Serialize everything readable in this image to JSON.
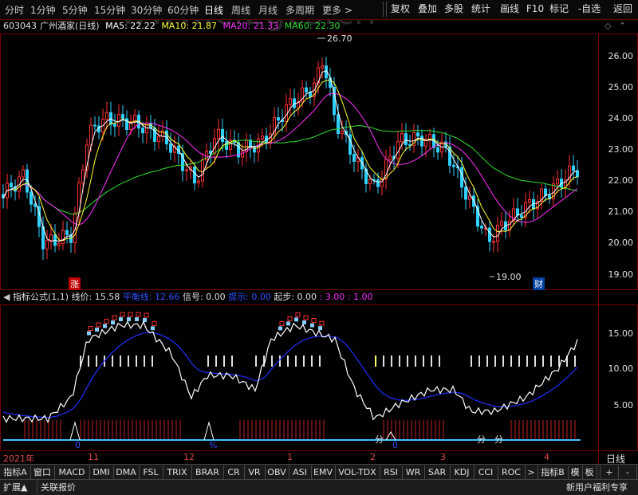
{
  "watermark": "www.cfzgcs.cn",
  "top_bar": {
    "period_tabs": [
      "分时",
      "1分钟",
      "5分钟",
      "15分钟",
      "30分钟",
      "60分钟",
      "日线",
      "周线",
      "月线",
      "多周期",
      "更多 >"
    ],
    "active_tab": "日线",
    "buttons": [
      "复权",
      "叠加",
      "多股",
      "统计",
      "画线",
      "F10",
      "标记",
      "-自选",
      "返回"
    ]
  },
  "info_line": {
    "code": "603043",
    "name": "广州酒家",
    "period": "(日线)",
    "ma5": "MA5: 22.22",
    "ma10": "MA10: 21.87",
    "ma20": "MA20: 21.33",
    "ma60": "MA60: 22.30",
    "icons": [
      "diamond-icon",
      "chevron-up-icon"
    ]
  },
  "price_axis": [
    "26.00",
    "25.00",
    "24.00",
    "23.00",
    "22.00",
    "21.00",
    "20.00",
    "19.00"
  ],
  "price_annotations": {
    "high": "26.70",
    "low": "19.00"
  },
  "markers": {
    "up": "涨",
    "fin": "财"
  },
  "indicator_line": {
    "title": "指标公式(1,1)",
    "line_price": "线价: 15.58",
    "balance_line": "平衡线: 12.66",
    "signal": "信号: 0.00",
    "hint": "提示: 0.00",
    "step": "起步: 0.00",
    "values": ": 3.00 : 1.00"
  },
  "indicator_axis": [
    "15.00",
    "10.00",
    "5.00"
  ],
  "indicator_marks": {
    "v1": "0",
    "v2": "%",
    "v3": "0",
    "v4": "分",
    "v5": "分",
    "v6": "分"
  },
  "date_axis": {
    "labels": [
      "2021年",
      "11",
      "12",
      "1",
      "2",
      "3",
      "4"
    ],
    "period": "日线"
  },
  "indicator_tabs": [
    "指标A",
    "窗口",
    "MACD",
    "DMI",
    "DMA",
    "FSL",
    "TRIX",
    "BRAR",
    "CR",
    "VR",
    "OBV",
    "ASI",
    "EMV",
    "VOL-TDX",
    "RSI",
    "WR",
    "SAR",
    "KDJ",
    "CCI",
    "ROC",
    ">",
    "指标B",
    "模",
    "板"
  ],
  "status_bar": {
    "expand": "扩展▲",
    "related": "关联报价",
    "right": "新用户福利专享"
  },
  "colors": {
    "up": "#ff3030",
    "down": "#30d0ff",
    "ma5": "#ffffff",
    "ma10": "#ffff30",
    "ma20": "#ff30ff",
    "ma60": "#30e030",
    "frame": "#7a0000"
  }
}
